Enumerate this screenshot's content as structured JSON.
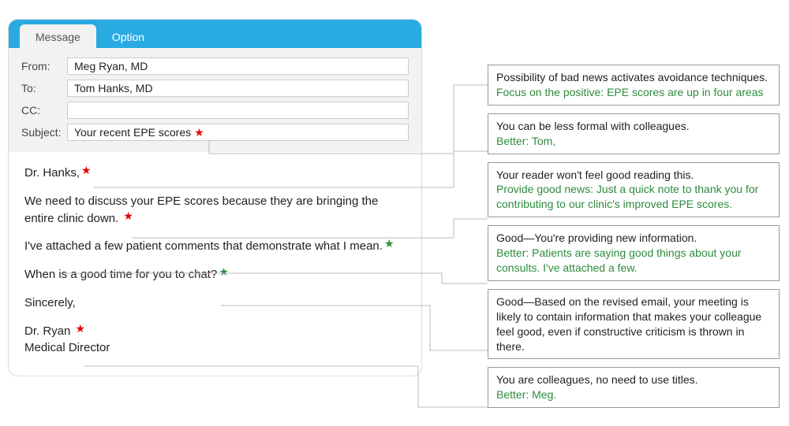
{
  "tabs": {
    "message": "Message",
    "option": "Option"
  },
  "fields": {
    "from_label": "From:",
    "from_value": "Meg Ryan, MD",
    "to_label": "To:",
    "to_value": "Tom Hanks, MD",
    "cc_label": "CC:",
    "cc_value": "",
    "subject_label": "Subject:",
    "subject_value": "Your recent EPE scores"
  },
  "body": {
    "greeting": "Dr. Hanks,",
    "p1": "We need to discuss your EPE scores because they are bringing the entire clinic down.",
    "p2": "I've attached a few patient comments that demonstrate what I mean.",
    "p3": "When is a good time for you to chat?",
    "signoff": "Sincerely,",
    "sig_name": "Dr. Ryan",
    "sig_title": "Medical Director"
  },
  "annotations": [
    {
      "comment": "Possibility of bad news activates avoidance techniques.",
      "suggestion": "Focus on the positive: EPE scores are up in four areas"
    },
    {
      "comment": "You can be less formal with colleagues.",
      "suggestion": "Better: Tom,"
    },
    {
      "comment": "Your reader won't feel good reading this.",
      "suggestion": "Provide good news: Just a quick note to thank you for contributing to our clinic's improved EPE scores."
    },
    {
      "comment": "Good—You're providing new information.",
      "suggestion": "Better: Patients are saying good things about your consults. I've attached a few."
    },
    {
      "comment": "Good—Based on the revised email, your meeting is likely to contain information that makes your colleague feel good, even if constructive criticism is thrown in there.",
      "suggestion": ""
    },
    {
      "comment": "You are colleagues, no need to use titles.",
      "suggestion": "Better: Meg."
    }
  ]
}
